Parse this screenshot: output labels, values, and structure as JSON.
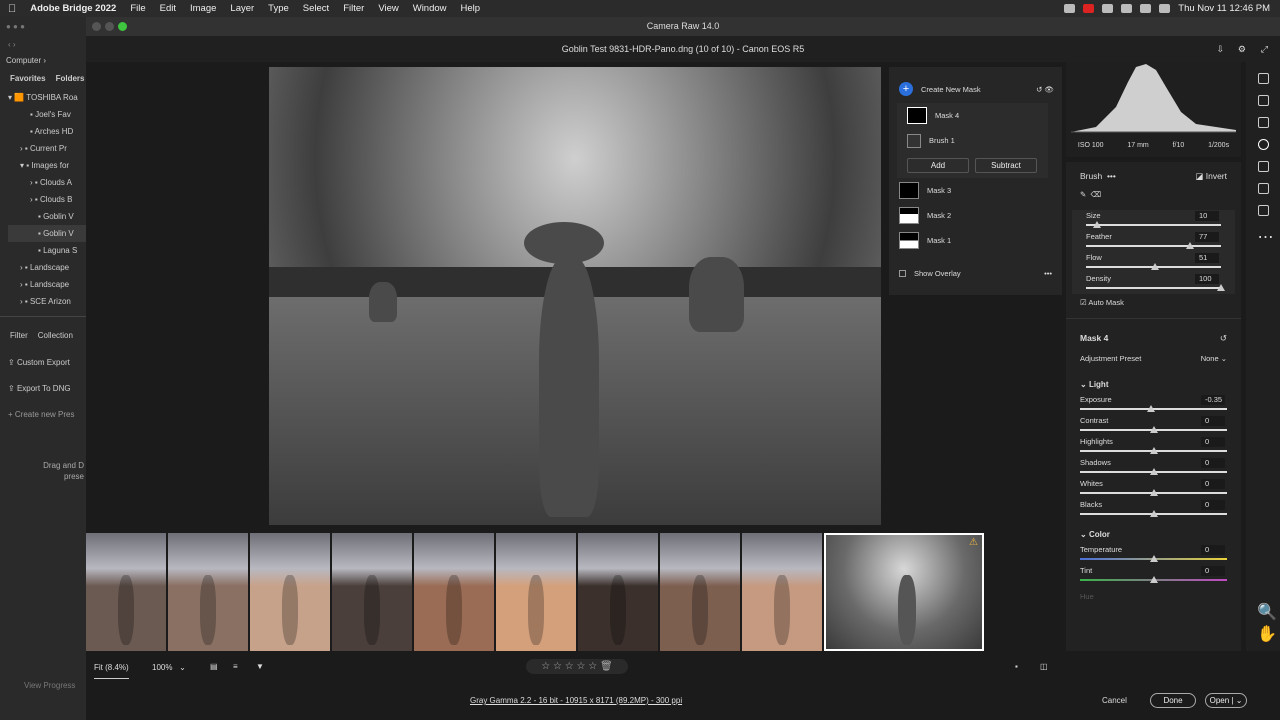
{
  "menubar": {
    "app": "Adobe Bridge 2022",
    "items": [
      "File",
      "Edit",
      "Image",
      "Layer",
      "Type",
      "Select",
      "Filter",
      "View",
      "Window",
      "Help"
    ],
    "datetime": "Thu Nov 11  12:46 PM"
  },
  "bridge": {
    "computer": "Computer",
    "tabs": [
      "Favorites",
      "Folders"
    ],
    "tree": [
      "TOSHIBA Roa",
      "Joel's Fav",
      "Arches HD",
      "Current Pr",
      "Images for",
      "Clouds A",
      "Clouds B",
      "Goblin V",
      "Goblin V",
      "Laguna S",
      "Landscape",
      "Landscape",
      "SCE Arizon"
    ],
    "panel_tabs": [
      "Filter",
      "Collection"
    ],
    "exports": [
      "Custom Export",
      "Export To DNG",
      "Create new Pres"
    ],
    "drag_text": "Drag and D",
    "drag_text2": "prese",
    "view_progress": "View Progress"
  },
  "window": {
    "title": "Camera Raw 14.0",
    "file": "Goblin Test 9831-HDR-Pano.dng (10 of 10)  -  Canon EOS R5"
  },
  "masks": {
    "create": "Create New Mask",
    "items": [
      "Mask 4",
      "Brush 1",
      "Mask 3",
      "Mask 2",
      "Mask 1"
    ],
    "add": "Add",
    "subtract": "Subtract",
    "overlay": "Show Overlay"
  },
  "hist": {
    "iso": "ISO 100",
    "focal": "17 mm",
    "aperture": "f/10",
    "shutter": "1/200s"
  },
  "brush": {
    "title": "Brush",
    "invert": "Invert",
    "auto_mask": "Auto Mask",
    "sliders": [
      {
        "label": "Size",
        "value": "10",
        "frac": 0.08
      },
      {
        "label": "Feather",
        "value": "77",
        "frac": 0.77
      },
      {
        "label": "Flow",
        "value": "51",
        "frac": 0.51
      },
      {
        "label": "Density",
        "value": "100",
        "frac": 1.0
      }
    ]
  },
  "mask_section": {
    "title": "Mask 4",
    "preset_label": "Adjustment Preset",
    "preset_value": "None"
  },
  "light": {
    "title": "Light",
    "sliders": [
      {
        "label": "Exposure",
        "value": "-0.35",
        "frac": 0.48
      },
      {
        "label": "Contrast",
        "value": "0",
        "frac": 0.5
      },
      {
        "label": "Highlights",
        "value": "0",
        "frac": 0.5
      },
      {
        "label": "Shadows",
        "value": "0",
        "frac": 0.5
      },
      {
        "label": "Whites",
        "value": "0",
        "frac": 0.5
      },
      {
        "label": "Blacks",
        "value": "0",
        "frac": 0.5
      }
    ]
  },
  "color": {
    "title": "Color",
    "sliders": [
      {
        "label": "Temperature",
        "value": "0",
        "frac": 0.5
      },
      {
        "label": "Tint",
        "value": "0",
        "frac": 0.5
      }
    ],
    "hue": "Hue"
  },
  "bottom": {
    "fit": "Fit (8.4%)",
    "zoom": "100%",
    "info": "Gray Gamma 2.2 - 16 bit - 10915 x 8171 (89.2MP) - 300 ppi",
    "cancel": "Cancel",
    "done": "Done",
    "open": "Open"
  },
  "film": {
    "tones": [
      "#6b5a52",
      "#8a7063",
      "#c7a28a",
      "#4a3f3a",
      "#9b6c55",
      "#d4a07c",
      "#3b302c",
      "#7d5f50",
      "#c59a80"
    ]
  }
}
